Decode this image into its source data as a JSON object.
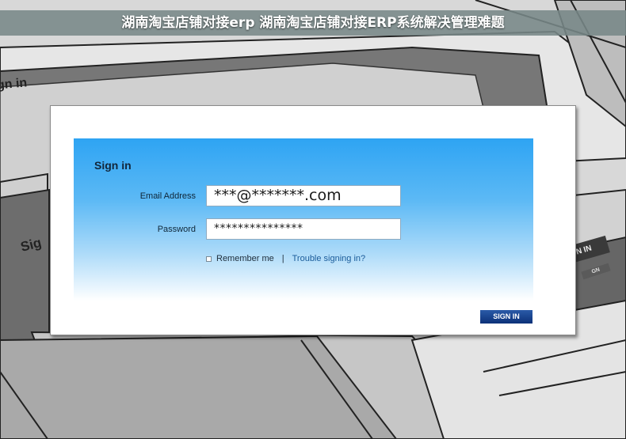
{
  "page_title": "湖南淘宝店铺对接erp 湖南淘宝店铺对接ERP系统解决管理难题",
  "background": {
    "sign_in_top_left": "gn in",
    "sign_in_mid_left": "Sig",
    "sign_in_tab_right": "N IN",
    "sign_in_tab_right_small": "GN"
  },
  "form": {
    "title": "Sign in",
    "email_label": "Email Address",
    "email_value": "***@*******.com",
    "password_label": "Password",
    "password_value": "***************",
    "remember_label": "Remember me",
    "separator": "|",
    "trouble_link": "Trouble signing in?",
    "submit_label": "SIGN IN"
  },
  "colors": {
    "panel_top": "#2ea4f3",
    "button": "#0c3178",
    "title_bar": "#788787"
  }
}
